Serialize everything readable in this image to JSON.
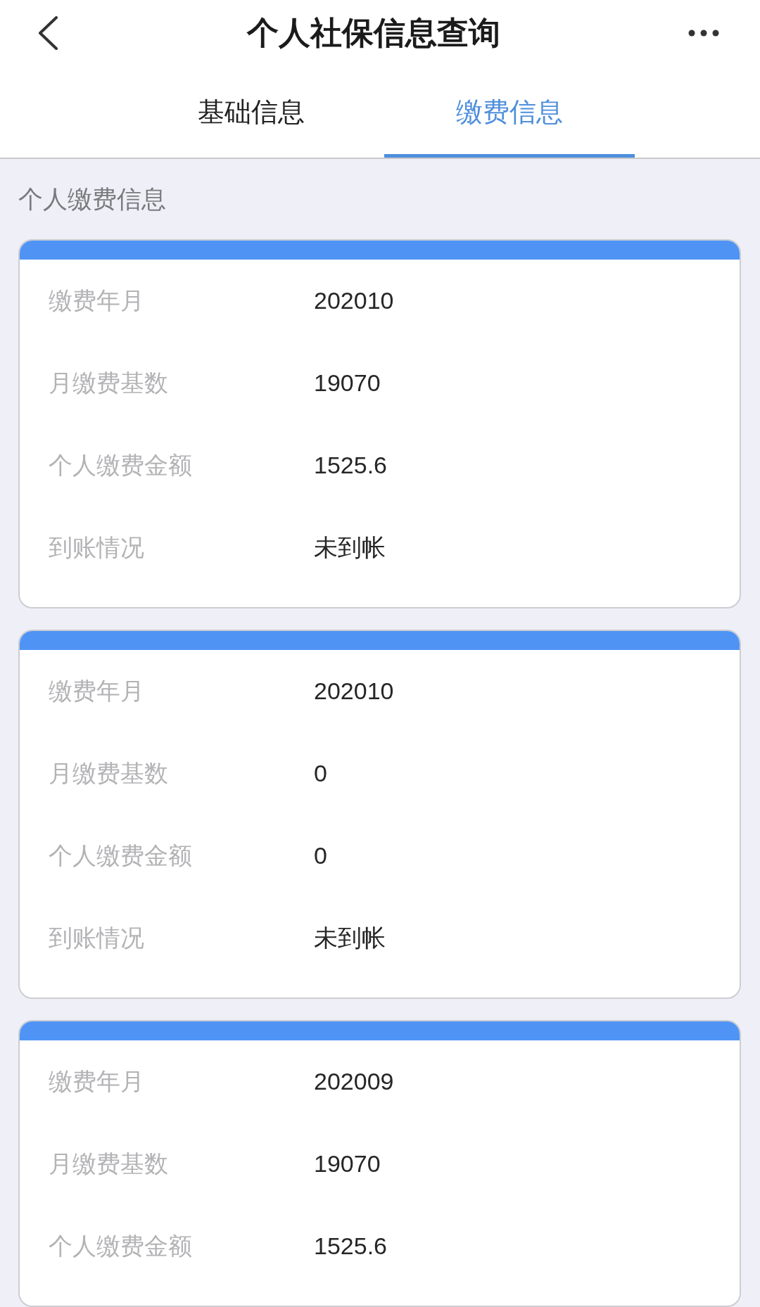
{
  "header": {
    "title": "个人社保信息查询"
  },
  "tabs": [
    {
      "label": "基础信息",
      "selected": false
    },
    {
      "label": "缴费信息",
      "selected": true
    }
  ],
  "section_title": "个人缴费信息",
  "records": [
    {
      "fields": [
        {
          "label": "缴费年月",
          "value": "202010"
        },
        {
          "label": "月缴费基数",
          "value": "19070"
        },
        {
          "label": "个人缴费金额",
          "value": "1525.6"
        },
        {
          "label": "到账情况",
          "value": "未到帐"
        }
      ]
    },
    {
      "fields": [
        {
          "label": "缴费年月",
          "value": "202010"
        },
        {
          "label": "月缴费基数",
          "value": "0"
        },
        {
          "label": "个人缴费金额",
          "value": "0"
        },
        {
          "label": "到账情况",
          "value": "未到帐"
        }
      ]
    },
    {
      "fields": [
        {
          "label": "缴费年月",
          "value": "202009"
        },
        {
          "label": "月缴费基数",
          "value": "19070"
        },
        {
          "label": "个人缴费金额",
          "value": "1525.6"
        }
      ]
    }
  ]
}
